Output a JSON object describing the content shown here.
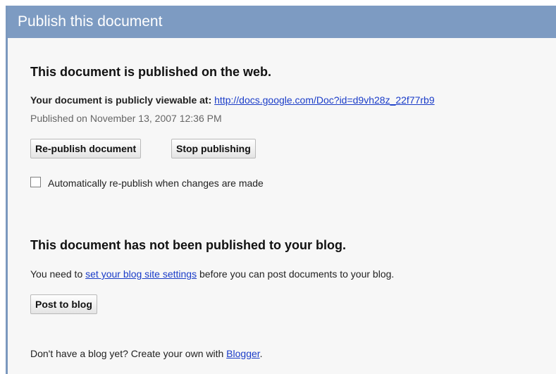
{
  "dialog": {
    "title": "Publish this document"
  },
  "web_section": {
    "heading": "This document is published on the web.",
    "viewable_label": "Your document is publicly viewable at:",
    "url": "http://docs.google.com/Doc?id=d9vh28z_22f77rb9",
    "published_on": "Published on November 13, 2007 12:36 PM",
    "republish_label": "Re-publish document",
    "stop_label": "Stop publishing",
    "auto_republish_label": "Automatically re-publish when changes are made",
    "auto_republish_checked": false
  },
  "blog_section": {
    "heading": "This document has not been published to your blog.",
    "need_prefix": "You need to",
    "settings_link": "set your blog site settings",
    "need_suffix": "before you can post documents to your blog.",
    "post_label": "Post to blog",
    "no_blog_prefix": "Don't have a blog yet? Create your own with",
    "blogger_link": "Blogger",
    "no_blog_suffix": "."
  }
}
